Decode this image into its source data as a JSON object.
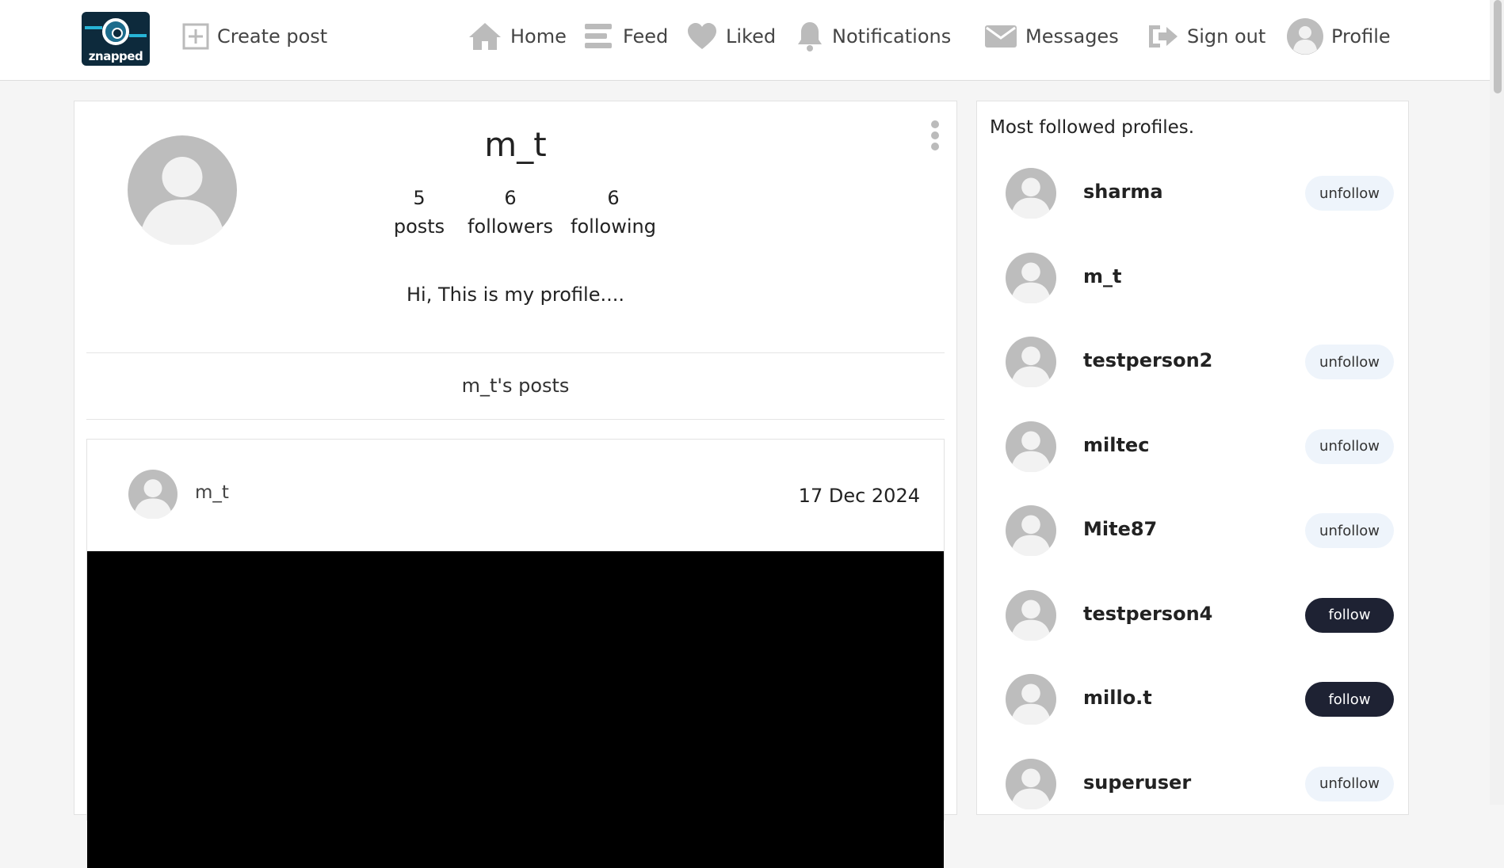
{
  "logo": {
    "text": "znapped"
  },
  "nav": {
    "create_post": "Create post",
    "home": "Home",
    "feed": "Feed",
    "liked": "Liked",
    "notifications": "Notifications",
    "messages": "Messages",
    "sign_out": "Sign out",
    "profile": "Profile"
  },
  "profile": {
    "username": "m_t",
    "stats": {
      "posts_count": "5",
      "posts_label": "posts",
      "followers_count": "6",
      "followers_label": "followers",
      "following_count": "6",
      "following_label": "following"
    },
    "bio": "Hi, This is my profile....",
    "posts_heading": "m_t's posts"
  },
  "post": {
    "author": "m_t",
    "date": "17 Dec 2024"
  },
  "sidebar": {
    "title": "Most followed profiles.",
    "profiles": [
      {
        "name": "sharma",
        "action": "unfollow"
      },
      {
        "name": "m_t",
        "action": ""
      },
      {
        "name": "testperson2",
        "action": "unfollow"
      },
      {
        "name": "miltec",
        "action": "unfollow"
      },
      {
        "name": "Mite87",
        "action": "unfollow"
      },
      {
        "name": "testperson4",
        "action": "follow"
      },
      {
        "name": "millo.t",
        "action": "follow"
      },
      {
        "name": "superuser",
        "action": "unfollow"
      }
    ]
  }
}
